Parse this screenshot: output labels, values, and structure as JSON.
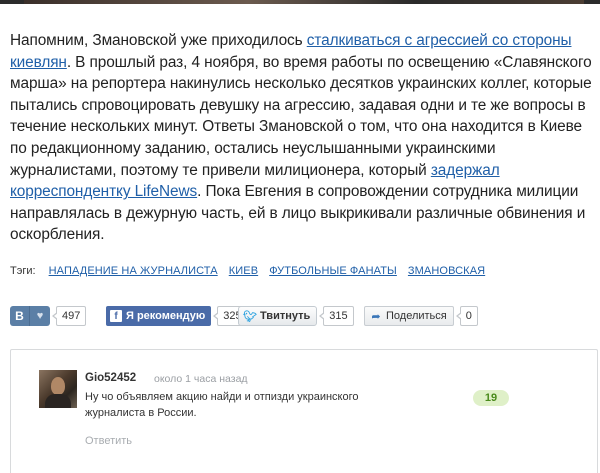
{
  "article": {
    "p1_part1": "Напомним, Змановской уже приходилось ",
    "p1_link1": "сталкиваться с агрессией со стороны киевлян",
    "p1_part2": ". В прошлый раз, 4 ноября, во время работы по освещению «Славянского марша» на репортера накинулись несколько десятков украинских коллег, которые пытались спровоцировать девушку на агрессию, задавая одни и те же вопросы в течение нескольких минут. Ответы Змановской о том, что она находится в Киеве по редакционному заданию, остались неуслышанными украинскими журналистами, поэтому те привели милиционера, который ",
    "p1_link2": "задержал корреспондентку LifeNews",
    "p1_part3": ". Пока Евгения в сопровождении сотрудника милиции направлялась в дежурную часть, ей в лицо выкрикивали различные обвинения и оскорбления."
  },
  "tags": {
    "label": "Тэги:",
    "items": [
      "НАПАДЕНИЕ НА ЖУРНАЛИСТА",
      "КИЕВ",
      "ФУТБОЛЬНЫЕ ФАНАТЫ",
      "ЗМАНОВСКАЯ"
    ]
  },
  "share": {
    "vk": {
      "letter": "В",
      "count": "497"
    },
    "fb": {
      "label": "Я рекомендую",
      "count": "325"
    },
    "twitter": {
      "label": "Твитнуть",
      "count": "315"
    },
    "generic": {
      "label": "Поделиться",
      "count": "0"
    }
  },
  "comments": [
    {
      "author": "Gio52452",
      "time": "около 1 часа назад",
      "text": "Ну чо объявляем акцию найди и отпизди украинского журналиста в России.",
      "reply_label": "Ответить",
      "rating": "19"
    }
  ],
  "colors": {
    "link": "#1f5fa8",
    "vk": "#5b7fa6",
    "fb": "#4a6ba8",
    "twitter": "#2ea3e0",
    "rating_bg": "#dff0c8",
    "rating_text": "#4a8a1c"
  },
  "icons": {
    "vk": "vk-icon",
    "like": "heart-icon",
    "fb": "facebook-icon",
    "twitter": "twitter-bird-icon",
    "share": "share-icon"
  }
}
